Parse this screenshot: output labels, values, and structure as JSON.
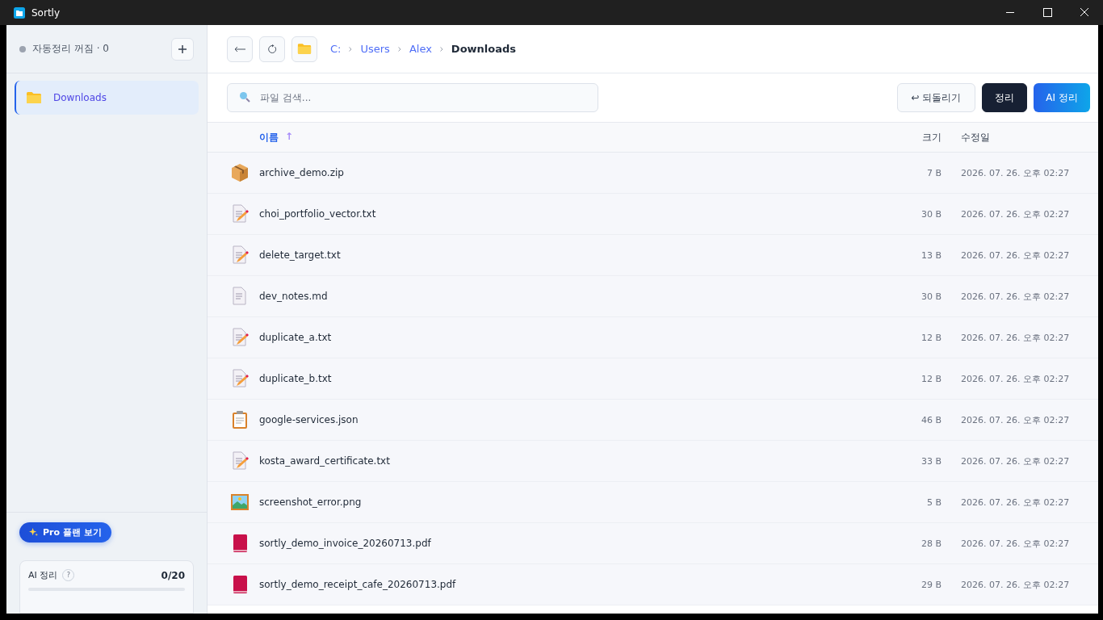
{
  "window": {
    "title": "Sortly"
  },
  "sidebar": {
    "status": "자동정리 꺼짐 · 0",
    "auto_sort_on": false,
    "folders": [
      {
        "label": "Downloads",
        "selected": true
      }
    ],
    "pro_button": "Pro 플랜 보기",
    "usage": {
      "label": "AI 정리",
      "help": "?",
      "count": "0/20",
      "level": 0
    }
  },
  "breadcrumb": [
    {
      "label": "C:",
      "current": false
    },
    {
      "label": "Users",
      "current": false
    },
    {
      "label": "Alex",
      "current": false
    },
    {
      "label": "Downloads",
      "current": true
    }
  ],
  "search": {
    "placeholder": "파일 검색..."
  },
  "actions": {
    "undo": "↩ 되돌리기",
    "sort": "정리",
    "ai_sort": "AI 정리"
  },
  "table": {
    "columns": [
      {
        "label": "이름",
        "sort": "↑"
      },
      {
        "label": "크기"
      },
      {
        "label": "수정일"
      }
    ],
    "rows": [
      {
        "kind": "zip",
        "name": "archive_demo.zip",
        "size": "7 B",
        "modified": "2026. 07. 26. 오후 02:27"
      },
      {
        "kind": "txt",
        "name": "choi_portfolio_vector.txt",
        "size": "30 B",
        "modified": "2026. 07. 26. 오후 02:27"
      },
      {
        "kind": "txt",
        "name": "delete_target.txt",
        "size": "13 B",
        "modified": "2026. 07. 26. 오후 02:27"
      },
      {
        "kind": "doc",
        "name": "dev_notes.md",
        "size": "30 B",
        "modified": "2026. 07. 26. 오후 02:27"
      },
      {
        "kind": "txt",
        "name": "duplicate_a.txt",
        "size": "12 B",
        "modified": "2026. 07. 26. 오후 02:27"
      },
      {
        "kind": "txt",
        "name": "duplicate_b.txt",
        "size": "12 B",
        "modified": "2026. 07. 26. 오후 02:27"
      },
      {
        "kind": "json",
        "name": "google-services.json",
        "size": "46 B",
        "modified": "2026. 07. 26. 오후 02:27"
      },
      {
        "kind": "txt",
        "name": "kosta_award_certificate.txt",
        "size": "33 B",
        "modified": "2026. 07. 26. 오후 02:27"
      },
      {
        "kind": "image",
        "name": "screenshot_error.png",
        "size": "5 B",
        "modified": "2026. 07. 26. 오후 02:27"
      },
      {
        "kind": "pdf",
        "name": "sortly_demo_invoice_20260713.pdf",
        "size": "28 B",
        "modified": "2026. 07. 26. 오후 02:27"
      },
      {
        "kind": "pdf",
        "name": "sortly_demo_receipt_cafe_20260713.pdf",
        "size": "29 B",
        "modified": "2026. 07. 26. 오후 02:27"
      }
    ]
  }
}
